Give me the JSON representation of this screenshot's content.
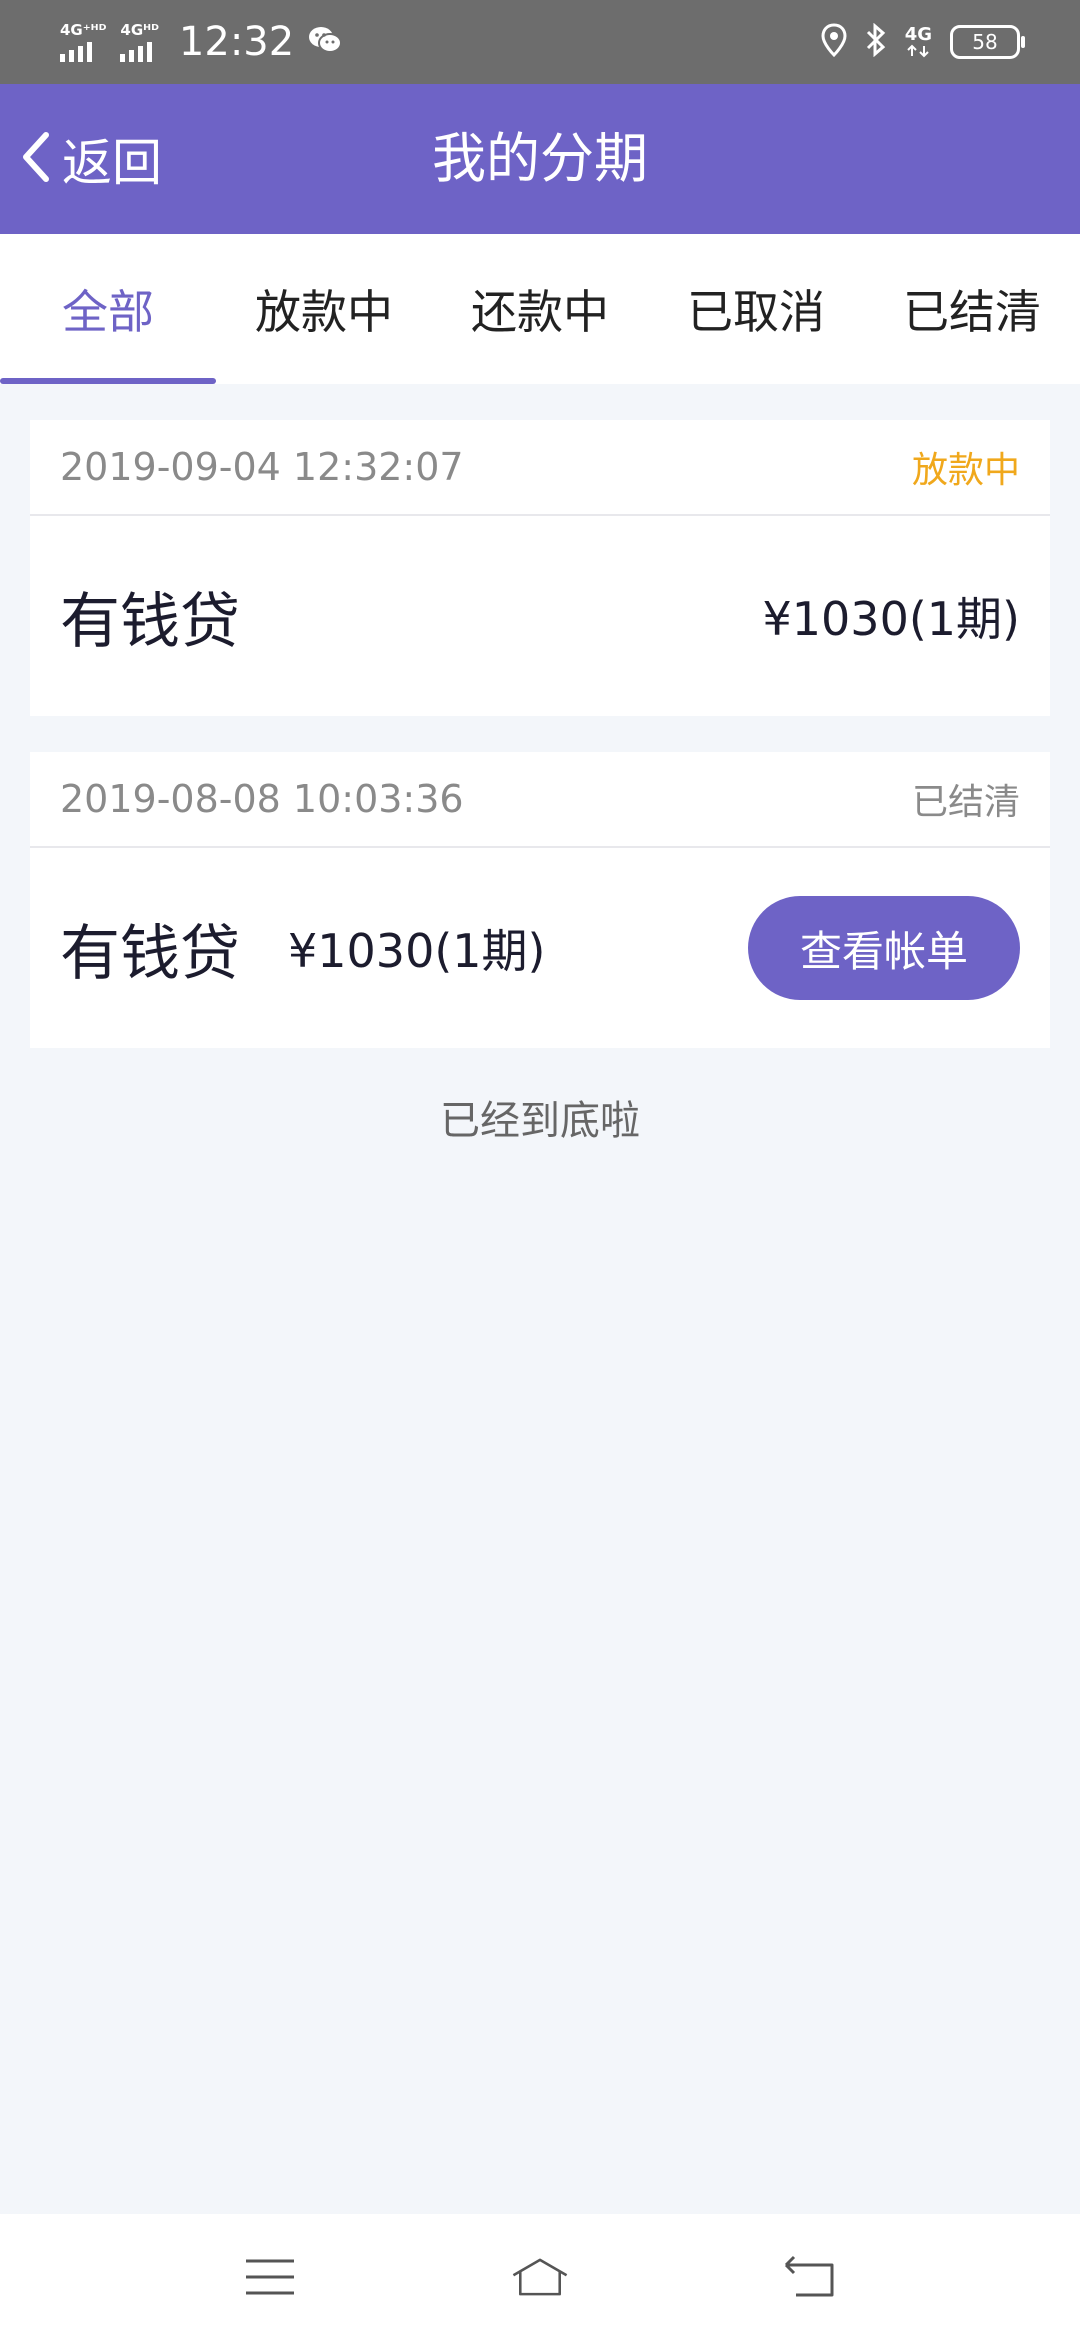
{
  "status_bar": {
    "net1": "4G⁺ᴴᴰ",
    "net2": "4Gᴴᴰ",
    "time": "12:32",
    "net3": "4G",
    "battery": "58",
    "icons": [
      "signal-icon",
      "signal-icon",
      "wechat-icon",
      "location-icon",
      "bluetooth-icon",
      "data-icon",
      "battery-icon"
    ]
  },
  "header": {
    "back_label": "返回",
    "title": "我的分期"
  },
  "tabs": [
    {
      "label": "全部",
      "active": true
    },
    {
      "label": "放款中",
      "active": false
    },
    {
      "label": "还款中",
      "active": false
    },
    {
      "label": "已取消",
      "active": false
    },
    {
      "label": "已结清",
      "active": false
    }
  ],
  "orders": [
    {
      "datetime": "2019-09-04 12:32:07",
      "status": "放款中",
      "product": "有钱贷",
      "amount": "¥1030(1期)"
    },
    {
      "datetime": "2019-08-08 10:03:36",
      "status": "已结清",
      "product": "有钱贷",
      "amount": "¥1030(1期)",
      "button": "查看帐单"
    }
  ],
  "end_text": "已经到底啦",
  "colors": {
    "primary": "#6e63c6",
    "pending": "#f0a81c",
    "background": "#f3f6fa"
  }
}
